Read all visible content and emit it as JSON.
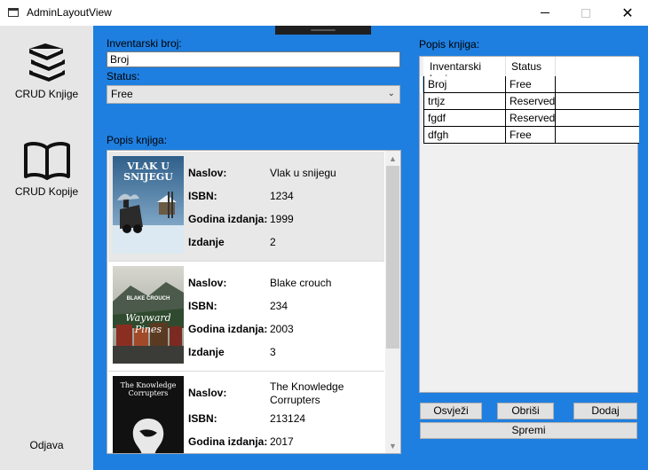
{
  "window": {
    "title": "AdminLayoutView"
  },
  "sidebar": {
    "items": [
      {
        "label": "CRUD Knjige",
        "icon": "books-icon"
      },
      {
        "label": "CRUD Kopije",
        "icon": "open-book-icon"
      }
    ],
    "logout_label": "Odjava"
  },
  "form": {
    "inventory_label": "Inventarski broj:",
    "inventory_value": "Broj",
    "status_label": "Status:",
    "status_value": "Free",
    "book_list_label": "Popis knjiga:"
  },
  "book_fields": {
    "title_label": "Naslov:",
    "isbn_label": "ISBN:",
    "year_label": "Godina izdanja:",
    "edition_label": "Izdanje"
  },
  "books": [
    {
      "title": "Vlak u snijegu",
      "isbn": "1234",
      "year": "1999",
      "edition": "2",
      "cover_text": "VLAK U SNIJEGU"
    },
    {
      "title": "Blake crouch",
      "isbn": "234",
      "year": "2003",
      "edition": "3",
      "cover_author": "BLAKE CROUCH",
      "cover_text": "Wayward Pines"
    },
    {
      "title": "The Knowledge Corrupters",
      "isbn": "213124",
      "year": "2017",
      "edition": "",
      "cover_text": "The Knowledge Corrupters"
    }
  ],
  "copies_panel": {
    "label": "Popis knjiga:",
    "columns": [
      "Inventarski broj",
      "Status"
    ],
    "rows": [
      {
        "inventory": "Broj",
        "status": "Free"
      },
      {
        "inventory": "trtjz",
        "status": "Reserved"
      },
      {
        "inventory": "fgdf",
        "status": "Reserved"
      },
      {
        "inventory": "dfgh",
        "status": "Free"
      }
    ]
  },
  "actions": {
    "refresh": "Osvježi",
    "delete": "Obriši",
    "add": "Dodaj",
    "save": "Spremi"
  },
  "colors": {
    "accent": "#1e7fe0",
    "sidebar_bg": "#e6e6e6"
  }
}
